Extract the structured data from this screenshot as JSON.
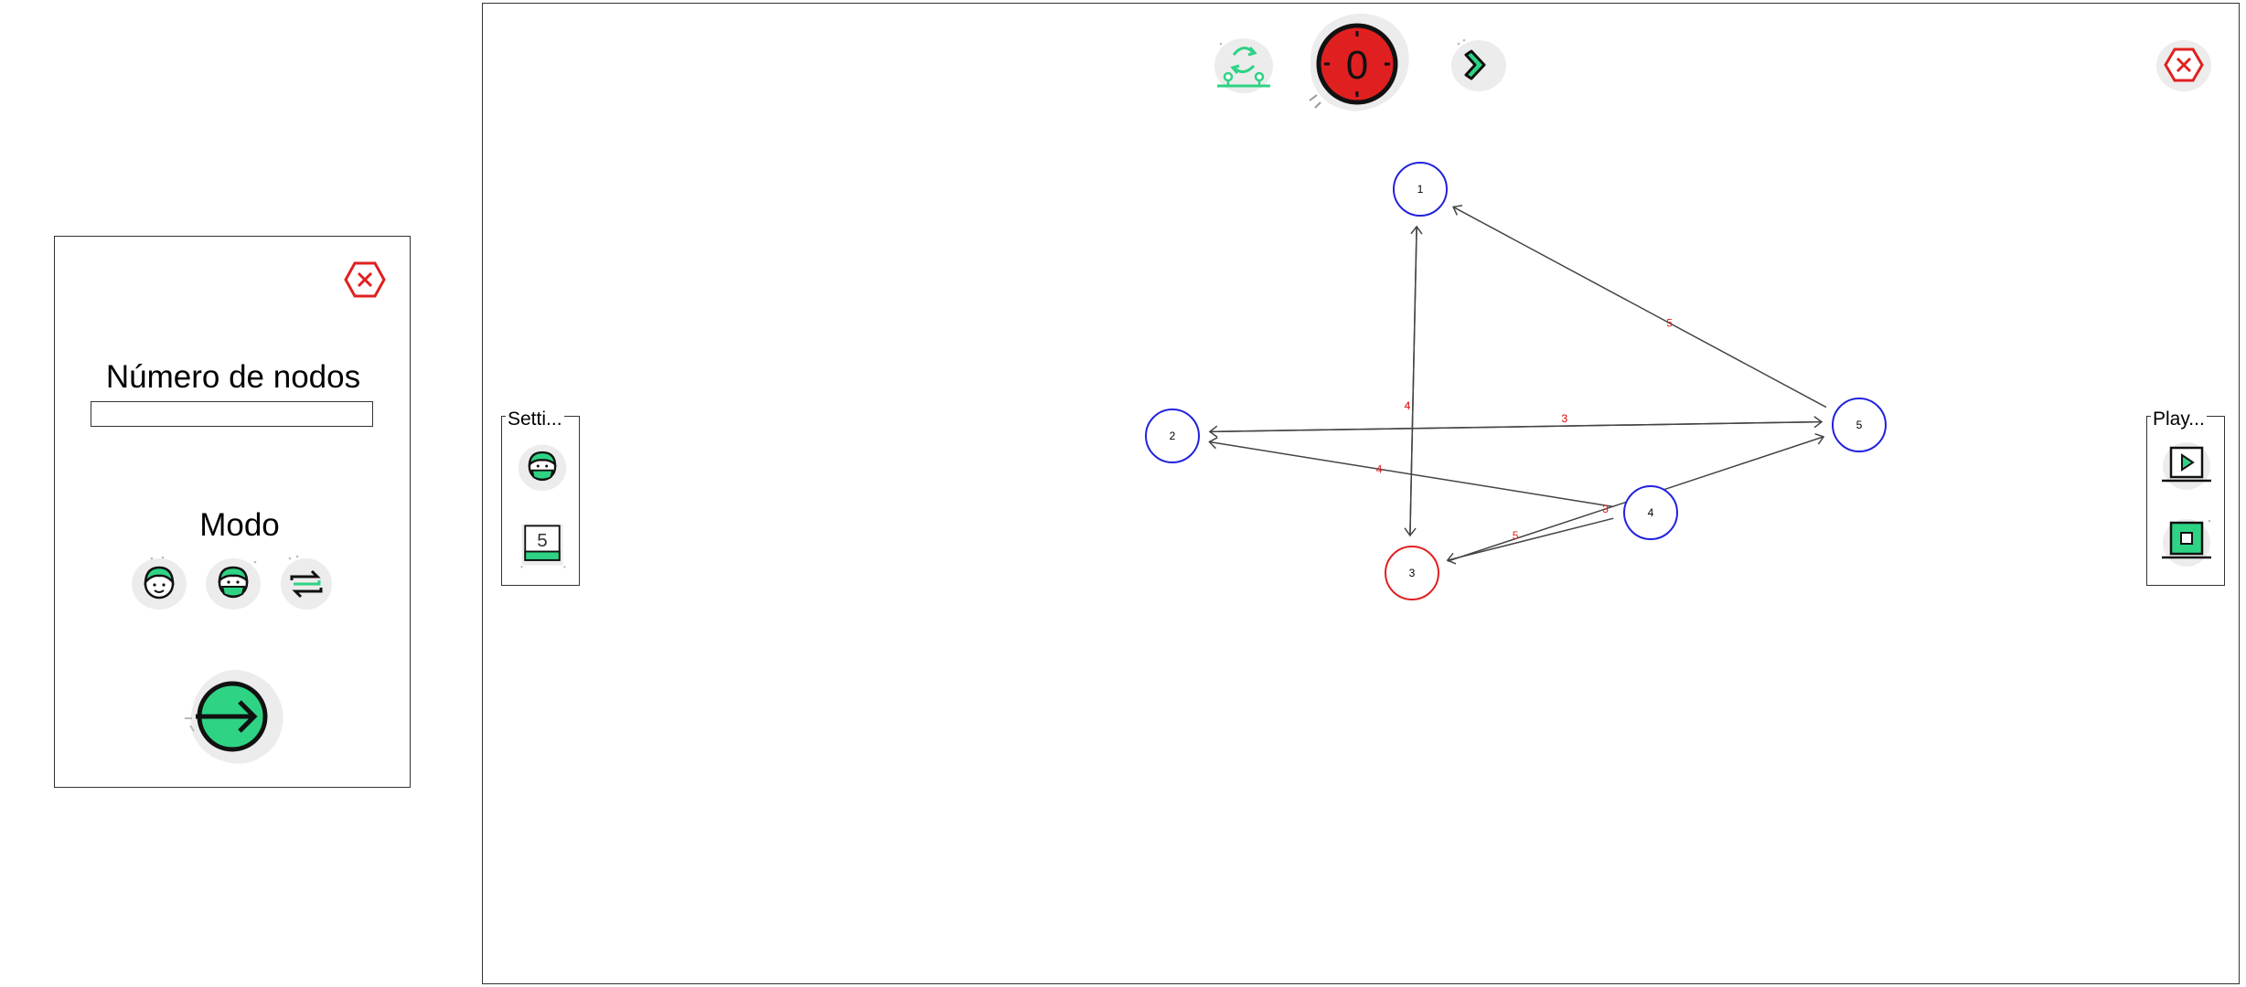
{
  "setup_dialog": {
    "nodes_title": "Número de nodos",
    "nodes_input_value": "",
    "mode_title": "Modo",
    "mode_options": [
      "person-mode-icon",
      "masked-person-mode-icon",
      "swap-mode-icon"
    ]
  },
  "toolbar": {
    "counter_value": "0",
    "icons": [
      "refresh-network-icon",
      "timer-icon",
      "next-step-icon",
      "close-icon"
    ]
  },
  "settings_group": {
    "legend": "Setti...",
    "step_value": "5"
  },
  "player_group": {
    "legend": "Play..."
  },
  "graph": {
    "nodes": [
      {
        "id": "1",
        "color": "#2222dd"
      },
      {
        "id": "2",
        "color": "#2222dd"
      },
      {
        "id": "3",
        "color": "#e02020"
      },
      {
        "id": "4",
        "color": "#2222dd"
      },
      {
        "id": "5",
        "color": "#2222dd"
      }
    ],
    "edges": [
      {
        "from": "3",
        "to": "1",
        "weight": "4"
      },
      {
        "from": "1",
        "to": "3",
        "weight": "4"
      },
      {
        "from": "5",
        "to": "1",
        "weight": "5"
      },
      {
        "from": "2",
        "to": "5",
        "weight": "3"
      },
      {
        "from": "5",
        "to": "2",
        "weight": "3"
      },
      {
        "from": "4",
        "to": "2",
        "weight": "4"
      },
      {
        "from": "3",
        "to": "5",
        "weight": "3"
      },
      {
        "from": "4",
        "to": "3",
        "weight": "5"
      }
    ]
  },
  "colors": {
    "accent_green": "#2ed384",
    "danger_red": "#e02020",
    "node_blue": "#2222dd",
    "blob_gray": "#ececec"
  }
}
